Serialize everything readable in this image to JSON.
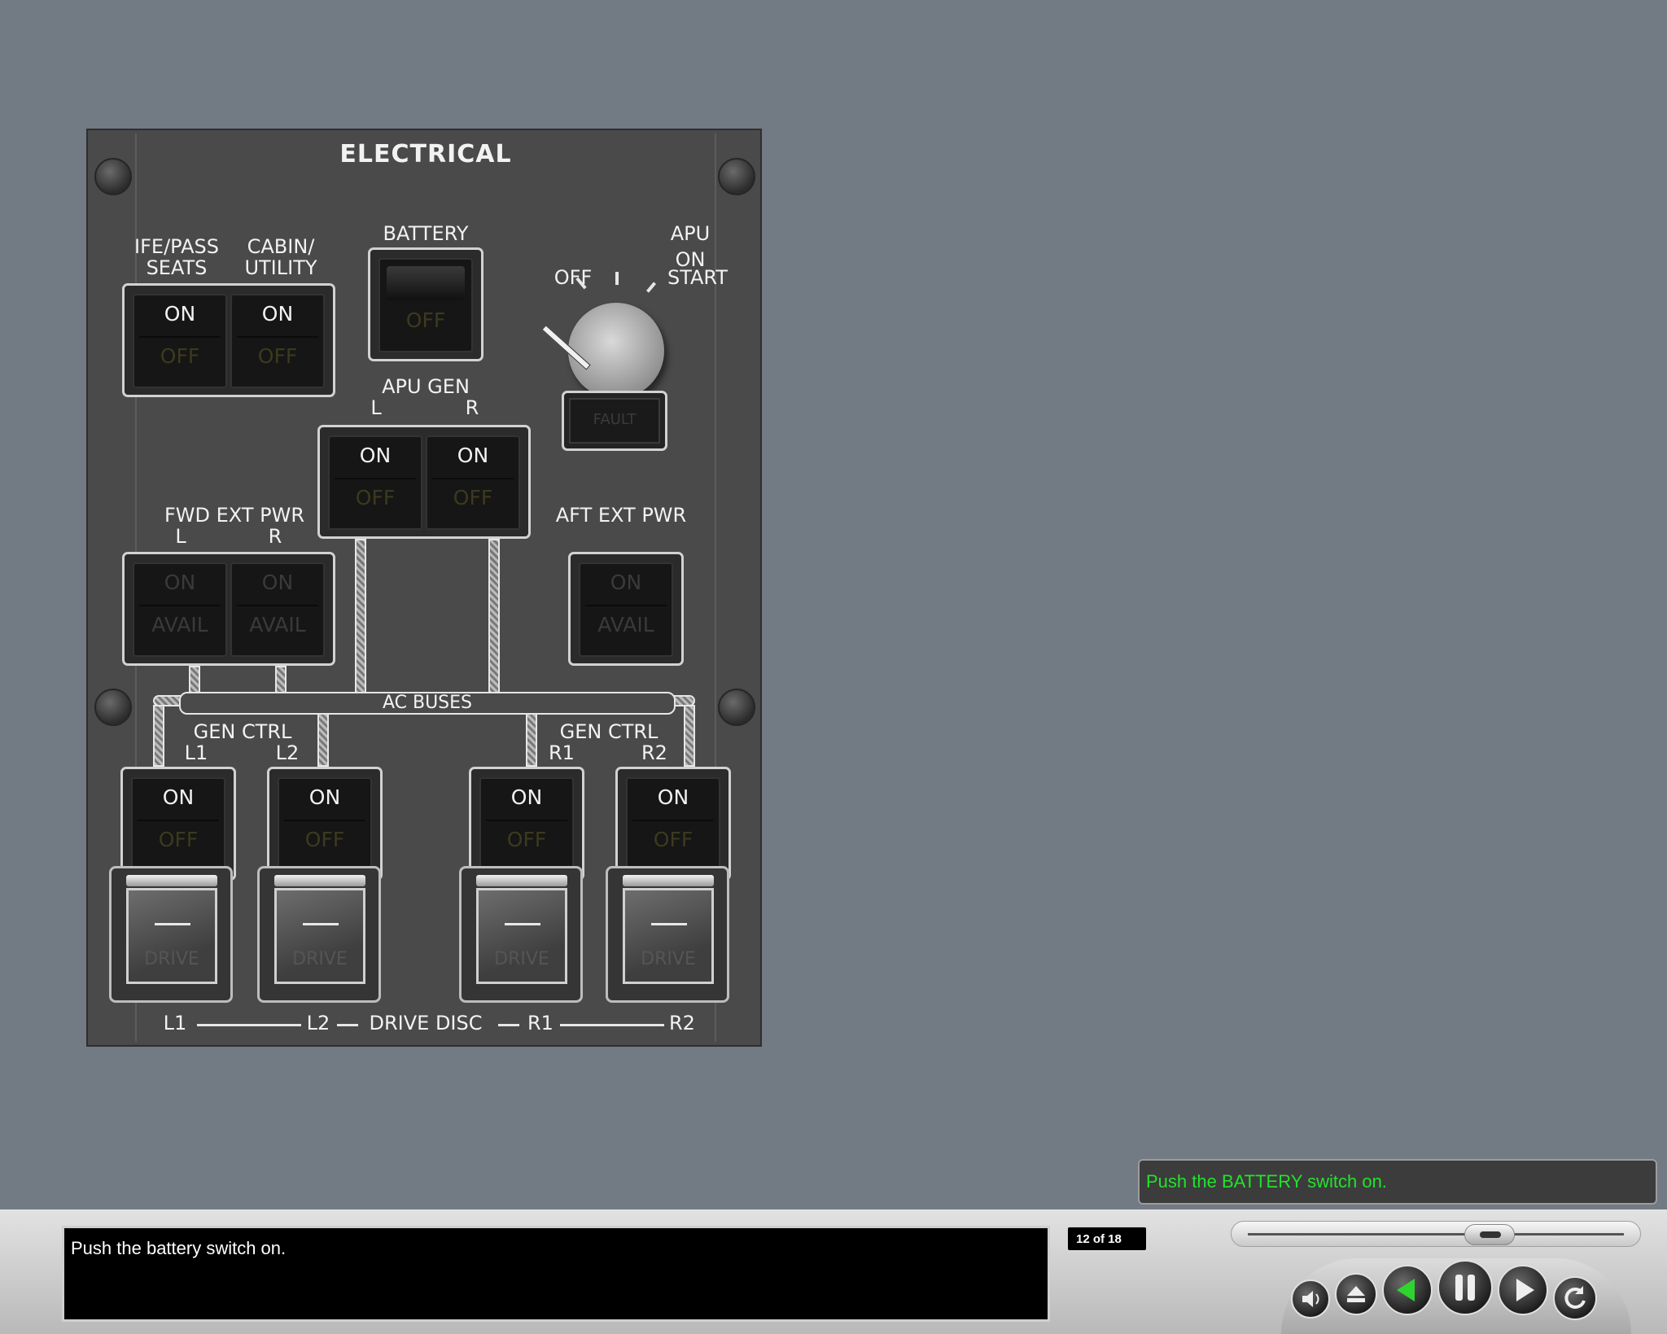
{
  "panel": {
    "title": "ELECTRICAL",
    "ife_pass_label_1": "IFE/PASS",
    "ife_pass_label_2": "SEATS",
    "cabin_label_1": "CABIN/",
    "cabin_label_2": "UTILITY",
    "battery_label": "BATTERY",
    "apu_label": "APU",
    "apu_positions": {
      "off": "OFF",
      "on": "ON",
      "start": "START"
    },
    "apu_fault": "FAULT",
    "apu_gen_label": "APU GEN",
    "side_l": "L",
    "side_r": "R",
    "fwd_ext_label": "FWD EXT PWR",
    "aft_ext_label": "AFT EXT PWR",
    "ac_buses": "AC BUSES",
    "gen_ctrl_label": "GEN CTRL",
    "l1": "L1",
    "l2": "L2",
    "r1": "R1",
    "r2": "R2",
    "drive_disc": "DRIVE DISC",
    "on": "ON",
    "off": "OFF",
    "avail": "AVAIL",
    "drive": "DRIVE"
  },
  "hint": "Push the BATTERY switch on.",
  "caption": "Push the battery switch on.",
  "counter": "12 of 18",
  "progress": {
    "current": 12,
    "total": 18
  },
  "icons": [
    "speaker-icon",
    "eject-icon",
    "back-icon",
    "pause-icon",
    "play-icon",
    "replay-icon"
  ]
}
